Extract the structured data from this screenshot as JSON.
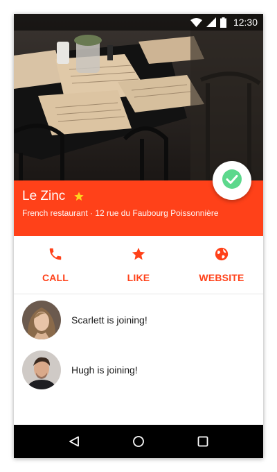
{
  "status_bar": {
    "time": "12:30",
    "icons": [
      "wifi-icon",
      "signal-icon",
      "battery-icon"
    ]
  },
  "place": {
    "name": "Le Zinc",
    "description": "French restaurant · 12 rue du Faubourg Poissonnière"
  },
  "actions": [
    {
      "label": "CALL",
      "icon": "phone-icon"
    },
    {
      "label": "LIKE",
      "icon": "star-icon"
    },
    {
      "label": "WEBSITE",
      "icon": "globe-icon"
    }
  ],
  "people": [
    {
      "text": "Scarlett is joining!"
    },
    {
      "text": "Hugh is joining!"
    }
  ],
  "nav": [
    "back-icon",
    "home-icon",
    "recents-icon"
  ],
  "colors": {
    "accent": "#ff4119",
    "check": "#5cd88c",
    "star": "#ffd21f"
  }
}
